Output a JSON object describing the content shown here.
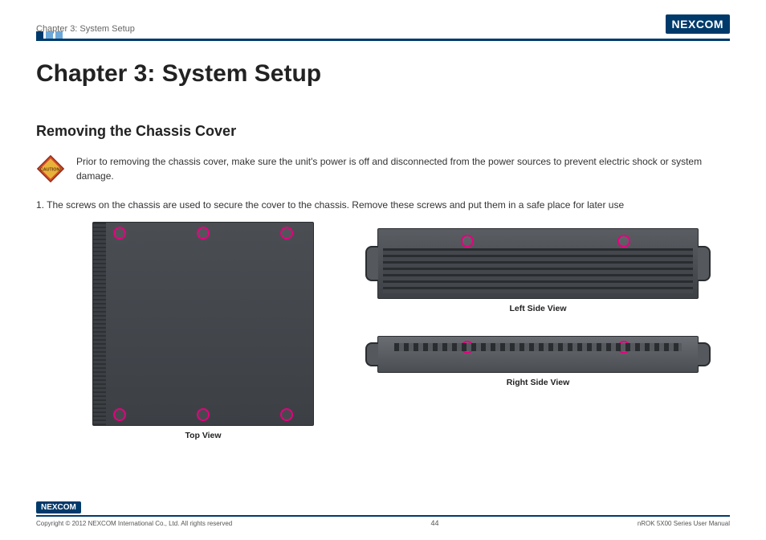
{
  "header": {
    "breadcrumb": "Chapter 3: System Setup",
    "logo_text": "NEXCOM"
  },
  "title": "Chapter 3: System Setup",
  "section_title": "Removing the Chassis Cover",
  "caution": {
    "icon_name": "caution-icon",
    "label": "CAUTION!",
    "text": "Prior to removing the chassis cover, make sure the unit's power is off and disconnected from the power sources to prevent electric shock or system damage."
  },
  "steps": [
    "1. The screws on the chassis are used to secure the cover to the chassis. Remove these screws and put them in a safe place for later use"
  ],
  "views": {
    "top": "Top View",
    "left": "Left Side View",
    "right": "Right Side View"
  },
  "footer": {
    "logo_text": "NEXCOM",
    "copyright": "Copyright © 2012 NEXCOM International Co., Ltd. All rights reserved",
    "page": "44",
    "doc": "nROK 5X00 Series User Manual"
  }
}
